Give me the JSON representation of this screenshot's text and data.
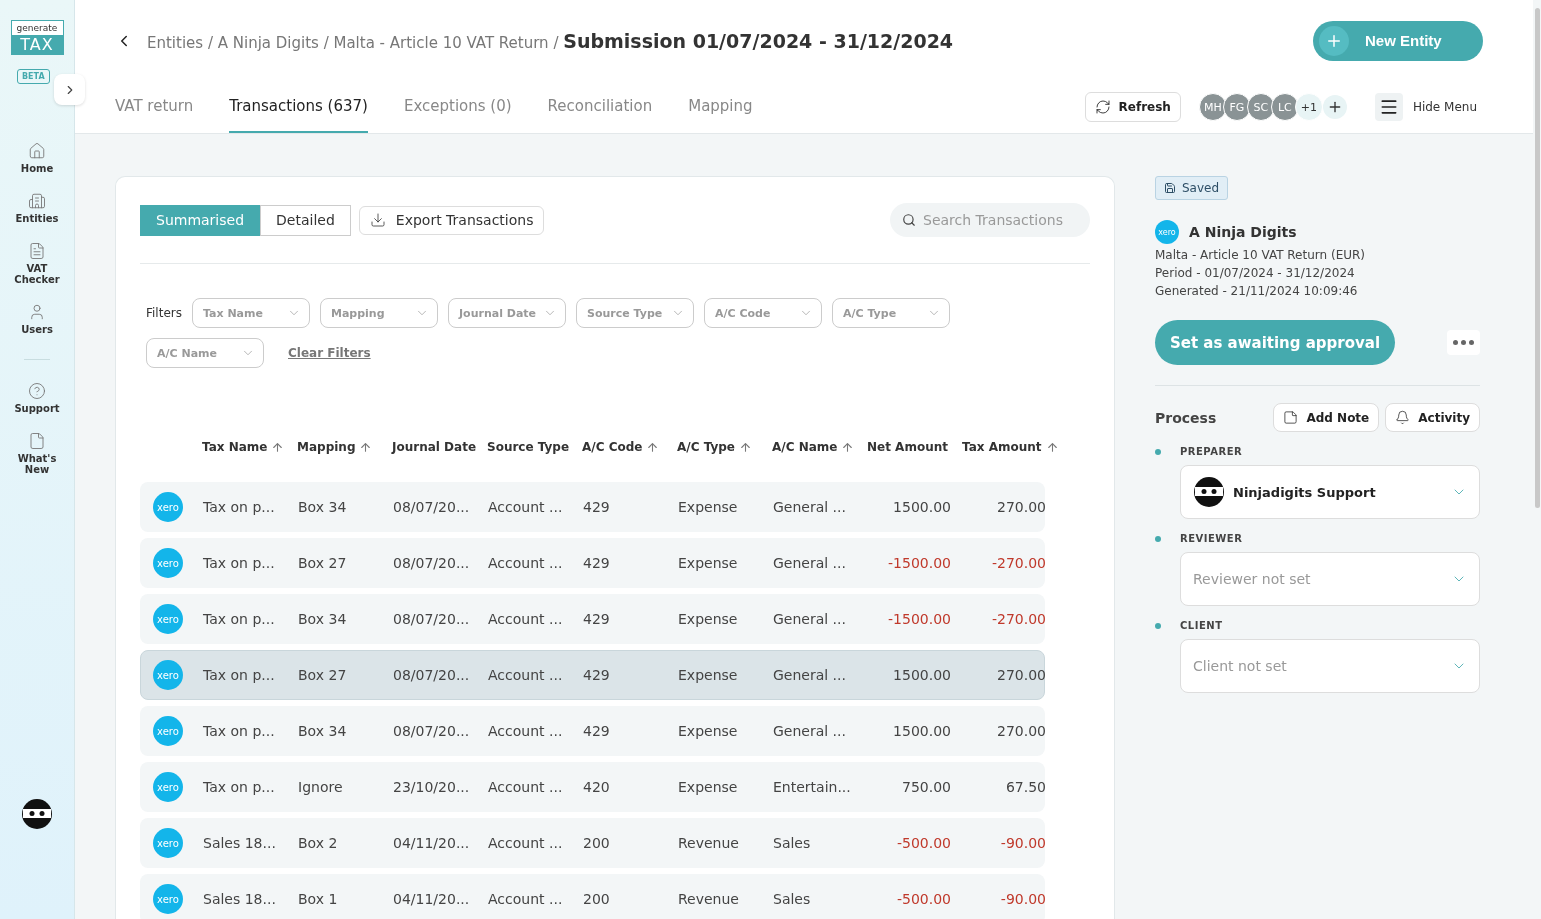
{
  "logo": {
    "top": "generate",
    "bottom": "TAX",
    "badge": "BETA"
  },
  "sidebar": {
    "items": [
      {
        "kind": "home",
        "label": "Home"
      },
      {
        "kind": "entities",
        "label": "Entities"
      },
      {
        "kind": "checker",
        "label": "VAT Checker"
      },
      {
        "kind": "users",
        "label": "Users"
      },
      {
        "kind": "divider"
      },
      {
        "kind": "support",
        "label": "Support"
      },
      {
        "kind": "news",
        "label": "What's New"
      }
    ]
  },
  "breadcrumb": {
    "path": "Entities / A Ninja Digits / Malta - Article 10 VAT Return /",
    "current": "Submission 01/07/2024 - 31/12/2024"
  },
  "new_entity_button": "New Entity",
  "tabs": [
    {
      "label": "VAT return",
      "selected": false
    },
    {
      "label": "Transactions (637)",
      "selected": true
    },
    {
      "label": "Exceptions (0)",
      "selected": false
    },
    {
      "label": "Reconciliation",
      "selected": false
    },
    {
      "label": "Mapping",
      "selected": false
    }
  ],
  "refresh_button": "Refresh",
  "avatars": [
    {
      "initials": "MH"
    },
    {
      "initials": "FG"
    },
    {
      "initials": "SC"
    },
    {
      "initials": "LC"
    }
  ],
  "more_avatars": "+1",
  "hide_menu": "Hide Menu",
  "view_toggle": [
    {
      "label": "Summarised",
      "selected": true
    },
    {
      "label": "Detailed",
      "selected": false
    }
  ],
  "export_button": "Export Transactions",
  "search": {
    "placeholder": "Search Transactions"
  },
  "filters_label": "Filters",
  "filters": [
    "Tax Name",
    "Mapping",
    "Journal Date",
    "Source Type",
    "A/C Code",
    "A/C Type",
    "A/C Name"
  ],
  "clear_filters": "Clear Filters",
  "table": {
    "columns": [
      {
        "label": "Tax Name",
        "sortable": true
      },
      {
        "label": "Mapping",
        "sortable": true
      },
      {
        "label": "Journal Date",
        "sortable": false
      },
      {
        "label": "Source Type",
        "sortable": false
      },
      {
        "label": "A/C Code",
        "sortable": true
      },
      {
        "label": "A/C Type",
        "sortable": true
      },
      {
        "label": "A/C Name",
        "sortable": true
      },
      {
        "label": "Net Amount",
        "sortable": false
      },
      {
        "label": "Tax Amount",
        "sortable": true
      }
    ],
    "rows": [
      {
        "logo": "xero",
        "selected": false,
        "negative": false,
        "cells": [
          "Tax on p...",
          "Box 34",
          "08/07/20...",
          "Account ...",
          "429",
          "Expense",
          "General ...",
          "1500.00",
          "270.00"
        ]
      },
      {
        "logo": "xero",
        "selected": false,
        "negative": true,
        "cells": [
          "Tax on p...",
          "Box 27",
          "08/07/20...",
          "Account ...",
          "429",
          "Expense",
          "General ...",
          "-1500.00",
          "-270.00"
        ]
      },
      {
        "logo": "xero",
        "selected": false,
        "negative": true,
        "cells": [
          "Tax on p...",
          "Box 34",
          "08/07/20...",
          "Account ...",
          "429",
          "Expense",
          "General ...",
          "-1500.00",
          "-270.00"
        ]
      },
      {
        "logo": "xero",
        "selected": true,
        "negative": false,
        "cells": [
          "Tax on p...",
          "Box 27",
          "08/07/20...",
          "Account ...",
          "429",
          "Expense",
          "General ...",
          "1500.00",
          "270.00"
        ]
      },
      {
        "logo": "xero",
        "selected": false,
        "negative": false,
        "cells": [
          "Tax on p...",
          "Box 34",
          "08/07/20...",
          "Account ...",
          "429",
          "Expense",
          "General ...",
          "1500.00",
          "270.00"
        ]
      },
      {
        "logo": "xero",
        "selected": false,
        "negative": false,
        "cells": [
          "Tax on p...",
          "Ignore",
          "23/10/20...",
          "Account ...",
          "420",
          "Expense",
          "Entertain...",
          "750.00",
          "67.50"
        ]
      },
      {
        "logo": "xero",
        "selected": false,
        "negative": true,
        "cells": [
          "Sales 18...",
          "Box 2",
          "04/11/20...",
          "Account ...",
          "200",
          "Revenue",
          "Sales",
          "-500.00",
          "-90.00"
        ]
      },
      {
        "logo": "xero",
        "selected": false,
        "negative": true,
        "cells": [
          "Sales 18...",
          "Box 1",
          "04/11/20...",
          "Account ...",
          "200",
          "Revenue",
          "Sales",
          "-500.00",
          "-90.00"
        ]
      }
    ]
  },
  "panel": {
    "saved": "Saved",
    "logo": "xero",
    "entity": "A Ninja Digits",
    "lines": [
      "Malta - Article 10 VAT Return (EUR)",
      "Period - 01/07/2024 - 31/12/2024",
      "Generated - 21/11/2024 10:09:46"
    ],
    "approve_button": "Set as awaiting approval",
    "process_title": "Process",
    "add_note": "Add Note",
    "activity": "Activity",
    "steps": [
      {
        "role": "PREPARER",
        "value": "Ninjadigits Support"
      },
      {
        "role": "REVIEWER",
        "placeholder": "Reviewer not set"
      },
      {
        "role": "CLIENT",
        "placeholder": "Client not set"
      }
    ]
  }
}
